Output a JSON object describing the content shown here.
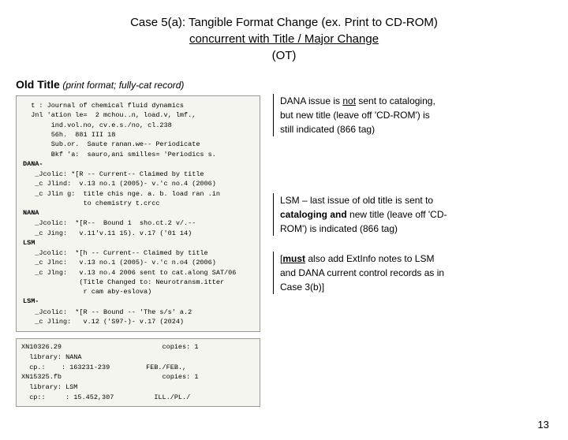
{
  "header": {
    "line1": "Case 5(a):  Tangible Format Change (ex. Print to CD-ROM)",
    "line2": "concurrent with Title / Major Change",
    "line3": "(OT)"
  },
  "old_title": {
    "label": "Old Title",
    "description": "(print format; fully-cat record)"
  },
  "record": {
    "lines": [
      "t : Journal of chemical fluid dynamics",
      "Jnl 'ation le=  2 mchou..n, load.v, lmf., ind.vol.no, cv.e.s./no, cl.238",
      "     56h.  881 III 18",
      "     Sub.or.  Saute ranan.we-- Periodicate",
      "     Bkf 'a:  sauro,ani smille s=  'Periodics s.",
      "",
      "DANA-",
      "   _Jcolic: *[R -- Current-- Claimed by title",
      "   _c Jlind:  v.13 no.1 (2005)- v.'c no.4 (2006)",
      "   _c Jlin g:  title chis nge. a. b. load ran .in  to chemistry t.crcc",
      "NANA",
      "   _Jcolic:  *[R--  Bound 1  sho.ct.2 v/.--",
      "   _c Jing:   v.11'v.11 15). v.17 ('01 14)",
      "LSM",
      "   _Jcolic:  *[h -- Current-- Claimed by title",
      "   _c Jlnc:   v.13 no.1 (2005)- v.'c n.o4 (2006)",
      "   _c Jlng:   v.13 no.4 2006 sent to cat.along SAT/06 (Title",
      "              Changed to: Neurotransm.itter r cam aby-eslova)",
      "",
      "LSM-",
      "   _Jcolic:  *[R -- Bound -- 'The s/s' a.2",
      "   _c Jling:   v.12 ('S97-)- v.17 (2024)"
    ],
    "holdings1": {
      "id": "XN10326.29",
      "copies": "copies: 1",
      "library": "library: NANA",
      "cpn": "cp:.    : 163231-239",
      "date": "FEB./FEB.,"
    },
    "holdings2": {
      "id": "XN15325.fb",
      "copies": "copies: 1",
      "library": "library: LSM",
      "cpn": "cp::     : 15.452,307",
      "date": "ILL./PL./"
    }
  },
  "info_top": {
    "text1": "DANA issue is ",
    "underline1": "not",
    "text2": " sent to cataloging,",
    "text3": "but new title (leave off 'CD-ROM') is",
    "text4": "still indicated  (866 tag)"
  },
  "info_bottom": {
    "text1": "LSM – last issue of old title is sent to",
    "text2_bold": "cataloging",
    "text2_rest": " and new title (leave off 'CD-",
    "text3": "ROM') is indicated (866 tag)"
  },
  "info_extra": {
    "bracket_open": "[",
    "underline1": "must",
    "text1": " also add ExtInfo notes to LSM",
    "text2": "and DANA current control records as in",
    "text3": "Case 3(b)]"
  },
  "page_number": "13"
}
